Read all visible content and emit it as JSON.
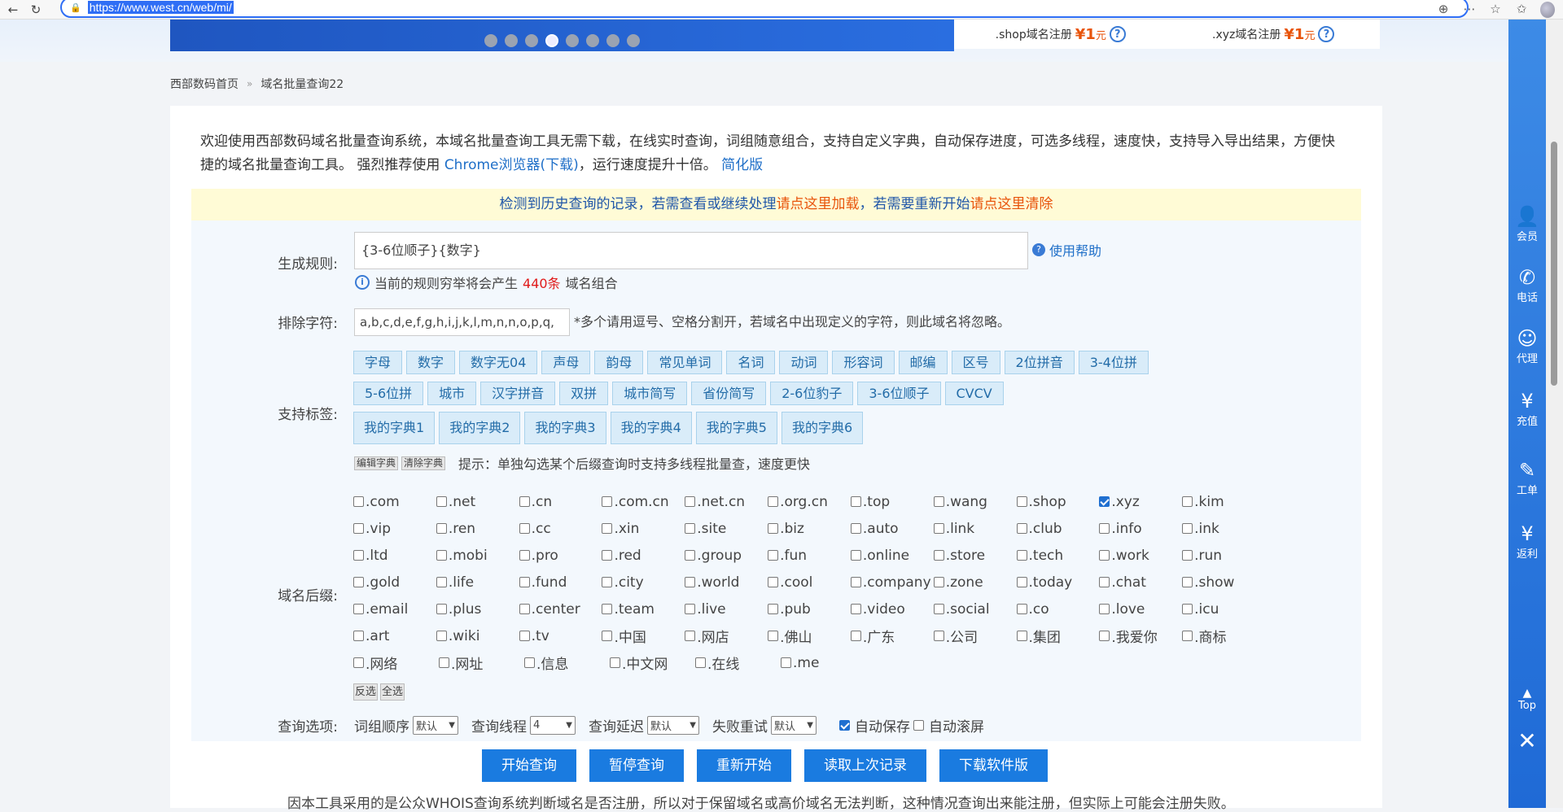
{
  "browser": {
    "url": "https://www.west.cn/web/mi/",
    "icons": [
      "back-arrow-icon",
      "refresh-icon",
      "lock-icon",
      "zoom-icon",
      "more-icon",
      "star-icon",
      "favorites-icon",
      "avatar"
    ]
  },
  "banner": {
    "slide_count": 8,
    "active_slide": 4,
    "promos": [
      {
        "label": ".shop域名注册",
        "price": "¥1",
        "unit": "元"
      },
      {
        "label": ".xyz域名注册",
        "price": "¥1",
        "unit": "元"
      }
    ]
  },
  "breadcrumb": {
    "home": "西部数码首页",
    "sep": "»",
    "current": "域名批量查询22"
  },
  "intro": {
    "text": "欢迎使用西部数码域名批量查询系统，本域名批量查询工具无需下载，在线实时查询，词组随意组合，支持自定义字典，自动保存进度，可选多线程，速度快，支持导入导出结果，方便快捷的域名批量查询工具。 强烈推荐使用 ",
    "chrome_link": "Chrome浏览器(下载)",
    "after_link": "，运行速度提升十倍。 ",
    "simple_link": "简化版"
  },
  "notice": {
    "prefix": "检测到历史查询的记录，若需查看或继续处理",
    "load_link": "请点这里加载",
    "middle": "，若需要重新开始",
    "clear_link": "请点这里清除"
  },
  "form": {
    "rule_label": "生成规则:",
    "rule_value": "{3-6位顺子}{数字}",
    "help_label": "使用帮助",
    "info_prefix": "当前的规则穷举将会产生",
    "info_count": "440条",
    "info_suffix": "域名组合",
    "exclude_label": "排除字符:",
    "exclude_value": "a,b,c,d,e,f,g,h,i,j,k,l,m,n,n,o,p,q,",
    "exclude_note": "*多个请用逗号、空格分割开，若域名中出现定义的字符，则此域名将忽略。",
    "tags_label": "支持标签:",
    "tags_row1": [
      "字母",
      "数字",
      "数字无04",
      "声母",
      "韵母",
      "常见单词",
      "名词",
      "动词",
      "形容词",
      "邮编",
      "区号",
      "2位拼音",
      "3-4位拼"
    ],
    "tags_row2": [
      "5-6位拼",
      "城市",
      "汉字拼音",
      "双拼",
      "城市简写",
      "省份简写",
      "2-6位豹子",
      "3-6位顺子",
      "CVCV"
    ],
    "tags_row3": [
      "我的字典1",
      "我的字典2",
      "我的字典3",
      "我的字典4",
      "我的字典5",
      "我的字典6"
    ],
    "edit_dict": "编辑字典",
    "clear_dict": "清除字典",
    "dict_tip": "提示：单独勾选某个后缀查询时支持多线程批量查，速度更快",
    "suffix_label": "域名后缀:",
    "suffixes": [
      [
        ".com",
        ".net",
        ".cn",
        ".com.cn",
        ".net.cn",
        ".org.cn",
        ".top",
        ".wang",
        ".shop",
        ".xyz",
        ".kim"
      ],
      [
        ".vip",
        ".ren",
        ".cc",
        ".xin",
        ".site",
        ".biz",
        ".auto",
        ".link",
        ".club",
        ".info",
        ".ink"
      ],
      [
        ".ltd",
        ".mobi",
        ".pro",
        ".red",
        ".group",
        ".fun",
        ".online",
        ".store",
        ".tech",
        ".work",
        ".run"
      ],
      [
        ".gold",
        ".life",
        ".fund",
        ".city",
        ".world",
        ".cool",
        ".company",
        ".zone",
        ".today",
        ".chat",
        ".show"
      ],
      [
        ".email",
        ".plus",
        ".center",
        ".team",
        ".live",
        ".pub",
        ".video",
        ".social",
        ".co",
        ".love",
        ".icu"
      ],
      [
        ".art",
        ".wiki",
        ".tv",
        ".中国",
        ".网店",
        ".佛山",
        ".广东",
        ".公司",
        ".集团",
        ".我爱你",
        ".商标"
      ],
      [
        ".网络",
        ".网址",
        ".信息",
        ".中文网",
        ".在线",
        ".me"
      ]
    ],
    "checked_suffix": ".xyz",
    "invert_btn": "反选",
    "select_all_btn": "全选",
    "options_label": "查询选项:",
    "order_label": "词组顺序",
    "order_value": "默认",
    "threads_label": "查询线程",
    "threads_value": "4",
    "delay_label": "查询延迟",
    "delay_value": "默认",
    "retry_label": "失败重试",
    "retry_value": "默认",
    "autosave_label": "自动保存",
    "autosave_checked": true,
    "autoscroll_label": "自动滚屏",
    "autoscroll_checked": false
  },
  "actions": [
    "开始查询",
    "暂停查询",
    "重新开始",
    "读取上次记录",
    "下载软件版"
  ],
  "bottom_text": "因本工具采用的是公众WHOIS查询系统判断域名是否注册，所以对于保留域名或高价域名无法判断，这种情况查询出来能注册，但实际上可能会注册失败。",
  "sidebar": {
    "items": [
      {
        "label": "会员",
        "icon": "user-icon"
      },
      {
        "label": "电话",
        "icon": "phone-icon"
      },
      {
        "label": "代理",
        "icon": "agent-icon"
      },
      {
        "label": "充值",
        "icon": "money-bag-icon"
      },
      {
        "label": "工单",
        "icon": "ticket-icon"
      },
      {
        "label": "返利",
        "icon": "rebate-icon"
      }
    ],
    "top_label": "Top"
  },
  "colors": {
    "accent": "#1a7be0",
    "sidebar": "#2a78de",
    "price": "#e8540b",
    "notice_bg": "#fffbd6"
  }
}
